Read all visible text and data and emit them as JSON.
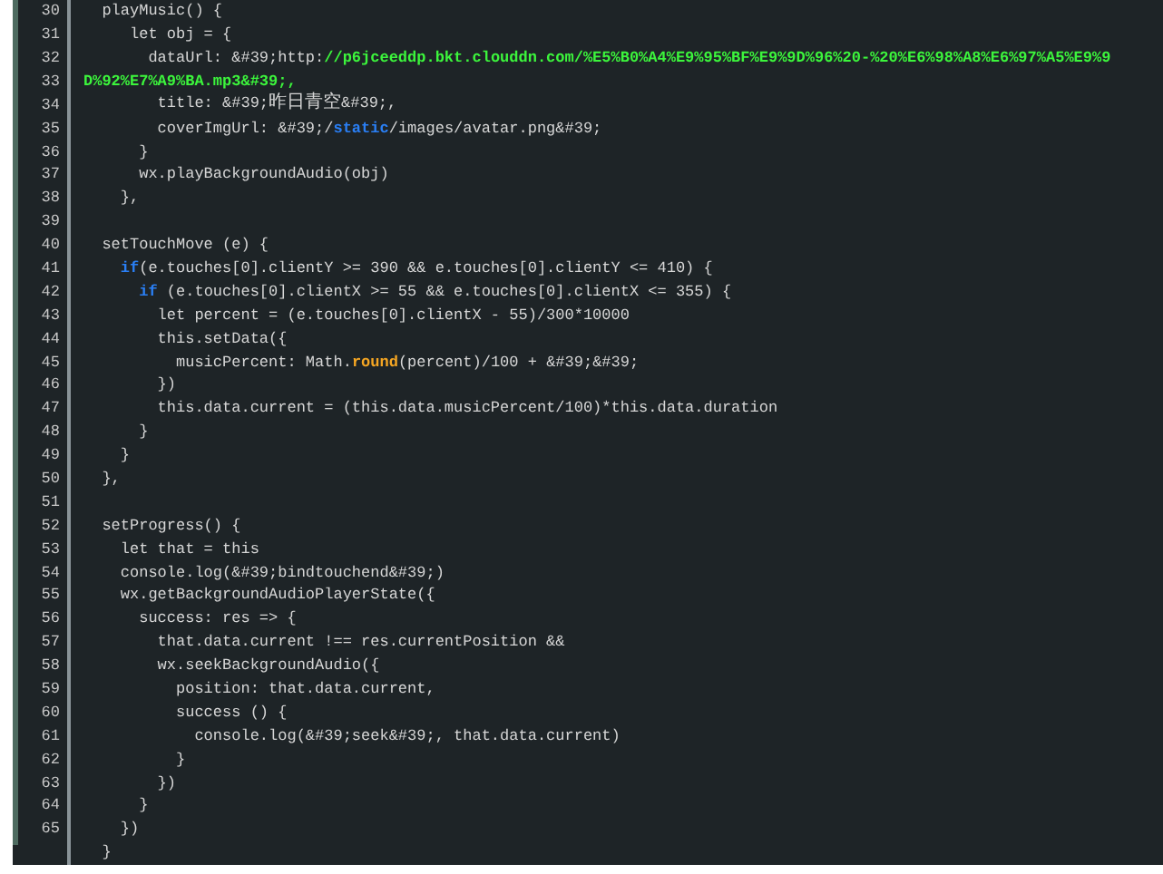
{
  "editor": {
    "lines": [
      {
        "number": "30",
        "tokens": [
          {
            "text": "  playMusic() {",
            "kind": "plain"
          }
        ]
      },
      {
        "number": "31",
        "tokens": [
          {
            "text": "     let obj = {",
            "kind": "plain"
          }
        ]
      },
      {
        "number": "32",
        "tokens": [
          {
            "text": "       dataUrl: &#39;http:",
            "kind": "plain"
          },
          {
            "text": "//p6jceeddp.bkt.clouddn.com/%E5%B0%A4%E9%95%BF%E9%9D%96%20-%20%E6%98%A8%E6%97%A5%E9%9",
            "kind": "string"
          }
        ]
      },
      {
        "number": "33",
        "tokens": [
          {
            "text": "D%92%E7%A9%BA.mp3&#39;,",
            "kind": "string"
          }
        ]
      },
      {
        "number": "34",
        "tokens": [
          {
            "text": "        title: &#39;",
            "kind": "plain"
          },
          {
            "text": "昨日青空",
            "kind": "cjk"
          },
          {
            "text": "&#39;,",
            "kind": "plain"
          }
        ]
      },
      {
        "number": "35",
        "tokens": [
          {
            "text": "        coverImgUrl: &#39;/",
            "kind": "plain"
          },
          {
            "text": "static",
            "kind": "keyword"
          },
          {
            "text": "/images/avatar.png&#39;",
            "kind": "plain"
          }
        ]
      },
      {
        "number": "36",
        "tokens": [
          {
            "text": "      }",
            "kind": "plain"
          }
        ]
      },
      {
        "number": "37",
        "tokens": [
          {
            "text": "      wx.playBackgroundAudio(obj)",
            "kind": "plain"
          }
        ]
      },
      {
        "number": "38",
        "tokens": [
          {
            "text": "    },",
            "kind": "plain"
          }
        ]
      },
      {
        "number": "39"
      },
      {
        "number": "40",
        "tokens": [
          {
            "text": "  setTouchMove (e) {",
            "kind": "plain"
          }
        ]
      },
      {
        "number": "41",
        "tokens": [
          {
            "text": "    if",
            "kind": "keyword"
          },
          {
            "text": "(e.touches[0].clientY >= 390 && e.touches[0].clientY <= 410) {",
            "kind": "plain"
          }
        ]
      },
      {
        "number": "42",
        "tokens": [
          {
            "text": "      if",
            "kind": "keyword"
          },
          {
            "text": " (e.touches[0].clientX >= 55 && e.touches[0].clientX <= 355) {",
            "kind": "plain"
          }
        ]
      },
      {
        "number": "43",
        "tokens": [
          {
            "text": "        let percent = (e.touches[0].clientX - 55)/300*10000",
            "kind": "plain"
          }
        ]
      },
      {
        "number": "44",
        "tokens": [
          {
            "text": "        this.setData({",
            "kind": "plain"
          }
        ]
      },
      {
        "number": "45",
        "tokens": [
          {
            "text": "          musicPercent: Math.",
            "kind": "plain"
          },
          {
            "text": "round",
            "kind": "function"
          },
          {
            "text": "(percent)/100 + &#39;&#39;",
            "kind": "plain"
          }
        ]
      },
      {
        "number": "46",
        "tokens": [
          {
            "text": "        })",
            "kind": "plain"
          }
        ]
      },
      {
        "number": "47",
        "tokens": [
          {
            "text": "        this.data.current = (this.data.musicPercent/100)*this.data.duration",
            "kind": "plain"
          }
        ]
      },
      {
        "number": "48",
        "tokens": [
          {
            "text": "      }",
            "kind": "plain"
          }
        ]
      },
      {
        "number": "49",
        "tokens": [
          {
            "text": "    }",
            "kind": "plain"
          }
        ]
      },
      {
        "number": "50",
        "tokens": [
          {
            "text": "  },",
            "kind": "plain"
          }
        ]
      },
      {
        "number": "51"
      },
      {
        "number": "52",
        "tokens": [
          {
            "text": "  setProgress() {",
            "kind": "plain"
          }
        ]
      },
      {
        "number": "53",
        "tokens": [
          {
            "text": "    let that = this",
            "kind": "plain"
          }
        ]
      },
      {
        "number": "54",
        "tokens": [
          {
            "text": "    console.log(&#39;bindtouchend&#39;)",
            "kind": "plain"
          }
        ]
      },
      {
        "number": "55",
        "tokens": [
          {
            "text": "    wx.getBackgroundAudioPlayerState({",
            "kind": "plain"
          }
        ]
      },
      {
        "number": "56",
        "tokens": [
          {
            "text": "      success: res => {",
            "kind": "plain"
          }
        ]
      },
      {
        "number": "57",
        "tokens": [
          {
            "text": "        that.data.current !== res.currentPosition &&",
            "kind": "plain"
          }
        ]
      },
      {
        "number": "58",
        "tokens": [
          {
            "text": "        wx.seekBackgroundAudio({",
            "kind": "plain"
          }
        ]
      },
      {
        "number": "59",
        "tokens": [
          {
            "text": "          position: that.data.current,",
            "kind": "plain"
          }
        ]
      },
      {
        "number": "60",
        "tokens": [
          {
            "text": "          success () {",
            "kind": "plain"
          }
        ]
      },
      {
        "number": "61",
        "tokens": [
          {
            "text": "            console.log(&#39;seek&#39;, that.data.current)",
            "kind": "plain"
          }
        ]
      },
      {
        "number": "62",
        "tokens": [
          {
            "text": "          }",
            "kind": "plain"
          }
        ]
      },
      {
        "number": "63",
        "tokens": [
          {
            "text": "        })",
            "kind": "plain"
          }
        ]
      },
      {
        "number": "64",
        "tokens": [
          {
            "text": "      }",
            "kind": "plain"
          }
        ]
      },
      {
        "number": "65",
        "tokens": [
          {
            "text": "    })",
            "kind": "plain"
          }
        ]
      },
      {
        "tokens": [
          {
            "text": "  }",
            "kind": "plain"
          }
        ]
      }
    ]
  }
}
